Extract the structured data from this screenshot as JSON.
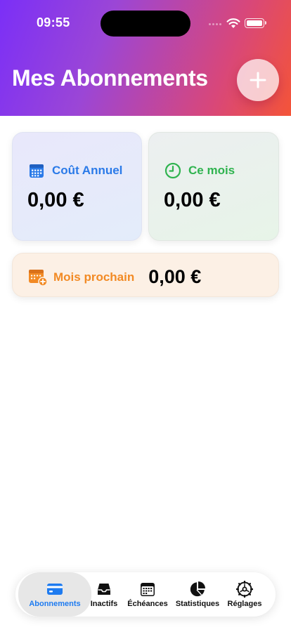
{
  "status_bar": {
    "time": "09:55"
  },
  "header": {
    "title": "Mes Abonnements",
    "add_icon": "plus-icon"
  },
  "cards": {
    "annual": {
      "label": "Coût Annuel",
      "value": "0,00 €",
      "icon": "calendar-icon",
      "color": "#2a7ae8"
    },
    "month": {
      "label": "Ce mois",
      "value": "0,00 €",
      "icon": "clock-icon",
      "color": "#2fb34f"
    },
    "next_month": {
      "label": "Mois prochain",
      "value": "0,00 €",
      "icon": "calendar-add-icon",
      "color": "#f28a24"
    }
  },
  "tabs": [
    {
      "label": "Abonnements",
      "icon": "credit-card-icon",
      "active": true
    },
    {
      "label": "Inactifs",
      "icon": "tray-icon",
      "active": false
    },
    {
      "label": "Échéances",
      "icon": "calendar-icon",
      "active": false
    },
    {
      "label": "Statistiques",
      "icon": "pie-chart-icon",
      "active": false
    },
    {
      "label": "Réglages",
      "icon": "gear-icon",
      "active": false
    }
  ],
  "colors": {
    "accent": "#1e7bf0",
    "header_start": "#7b2ff7",
    "header_end": "#f45438"
  }
}
